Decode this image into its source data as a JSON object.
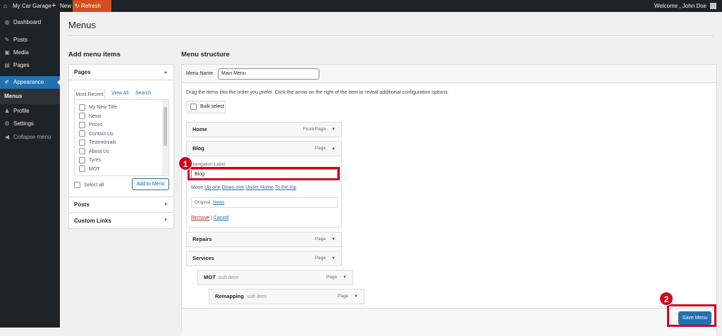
{
  "adminbar": {
    "site": "My Car Garage",
    "new": "New",
    "refresh": "Refresh Page",
    "welcome": "Welcome , John Doe"
  },
  "sidebar": {
    "items": [
      {
        "label": "Dashboard",
        "icon": "dashboard-icon"
      },
      {
        "label": "Posts",
        "icon": "pin-icon"
      },
      {
        "label": "Media",
        "icon": "media-icon"
      },
      {
        "label": "Pages",
        "icon": "pages-icon"
      },
      {
        "label": "Appearance",
        "icon": "brush-icon"
      },
      {
        "label": "Menus"
      },
      {
        "label": "Profile",
        "icon": "user-icon"
      },
      {
        "label": "Settings",
        "icon": "gear-icon"
      },
      {
        "label": "Collapse menu",
        "icon": "collapse-icon"
      }
    ]
  },
  "page_title": "Menus",
  "left": {
    "heading": "Add menu items",
    "pages_title": "Pages",
    "tabs": [
      "Most Recent",
      "View All",
      "Search"
    ],
    "pages": [
      "My New Title",
      "News",
      "Prices",
      "Contact Us",
      "Testimonials",
      "About Us",
      "Tyres",
      "MOT"
    ],
    "select_all": "Select all",
    "add_button": "Add to Menu",
    "posts_title": "Posts",
    "custom_links_title": "Custom Links"
  },
  "right": {
    "heading": "Menu structure",
    "menu_name_label": "Menu Name",
    "menu_name_value": "Main Menu",
    "instructions": "Drag the items into the order you prefer. Click the arrow on the right of the item to reveal additional configuration options.",
    "bulk_select": "Bulk select",
    "items": [
      {
        "title": "Home",
        "type": "Front Page"
      },
      {
        "title": "Blog",
        "type": "Page"
      },
      {
        "title": "Repairs",
        "type": "Page"
      },
      {
        "title": "Services",
        "type": "Page"
      },
      {
        "title": "MOT",
        "sub": "sub item",
        "type": "Page"
      },
      {
        "title": "Remapping",
        "sub": "sub item",
        "type": "Page"
      }
    ],
    "blog_panel": {
      "nav_label": "Navigation Label",
      "nav_value": "Blog",
      "move": "Move",
      "move_links": [
        "Up one",
        "Down one",
        "Under Home",
        "To the top"
      ],
      "original_label": "Original:",
      "original_link": "News",
      "remove": "Remove",
      "cancel": "Cancel",
      "sep": "|"
    },
    "save_button": "Save Menu"
  },
  "callouts": [
    "1",
    "2"
  ],
  "colors": {
    "accent": "#2271b1",
    "highlight": "#d0021b",
    "refresh": "#d54e21"
  }
}
